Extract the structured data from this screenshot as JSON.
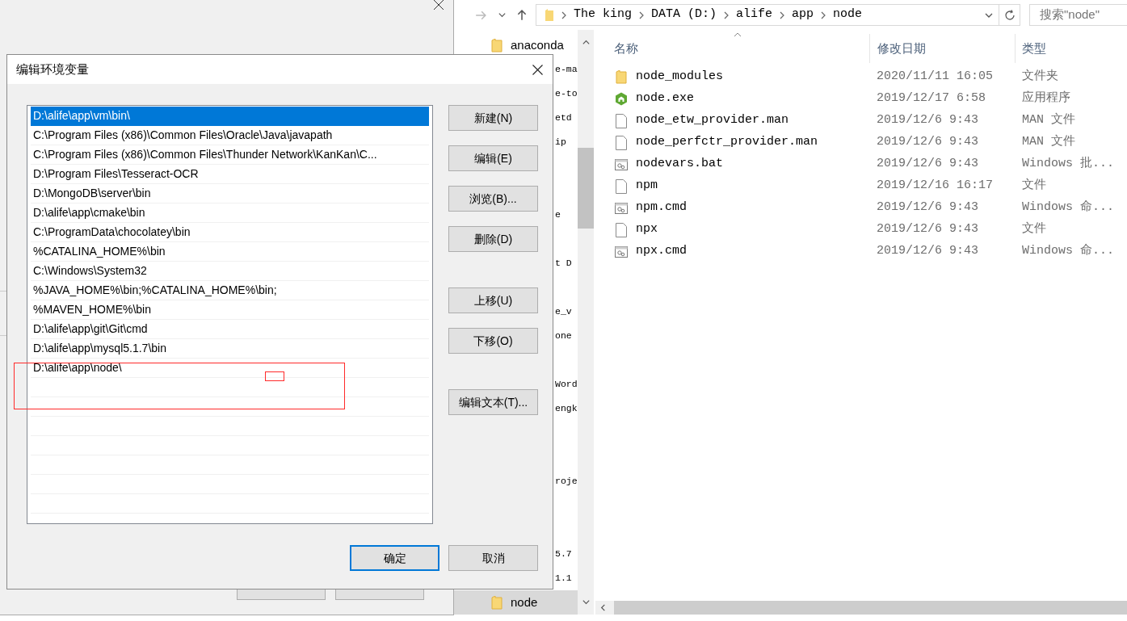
{
  "background_dialog": {
    "buttons": [
      {
        "default": false
      },
      {
        "default": false
      }
    ]
  },
  "explorer": {
    "address": {
      "crumbs": [
        "The king",
        "DATA (D:)",
        "alife",
        "app",
        "node"
      ]
    },
    "search": {
      "placeholder": "搜索\"node\""
    },
    "nav_items": [
      {
        "kind": "folder",
        "label": "anaconda",
        "selected": false
      },
      {
        "kind": "cut",
        "label": "e-ma"
      },
      {
        "kind": "cut",
        "label": "e-to"
      },
      {
        "kind": "cut",
        "label": "etd"
      },
      {
        "kind": "cut",
        "label": "ip"
      },
      {
        "kind": "hidden"
      },
      {
        "kind": "hidden"
      },
      {
        "kind": "cut",
        "label": "e"
      },
      {
        "kind": "hidden"
      },
      {
        "kind": "cut",
        "label": "t D"
      },
      {
        "kind": "hidden"
      },
      {
        "kind": "cut",
        "label": "e_v"
      },
      {
        "kind": "cut",
        "label": "one"
      },
      {
        "kind": "hidden"
      },
      {
        "kind": "cut",
        "label": "Word"
      },
      {
        "kind": "cut",
        "label": "engk"
      },
      {
        "kind": "hidden"
      },
      {
        "kind": "hidden"
      },
      {
        "kind": "cut",
        "label": "roje"
      },
      {
        "kind": "hidden"
      },
      {
        "kind": "hidden"
      },
      {
        "kind": "cut",
        "label": "5.7"
      },
      {
        "kind": "cut",
        "label": "1.1"
      },
      {
        "kind": "folder",
        "label": "node",
        "selected": true
      }
    ],
    "columns": [
      "名称",
      "修改日期",
      "类型"
    ],
    "files": [
      {
        "kind": "folder",
        "name": "node_modules",
        "modified": "2020/11/11 16:05",
        "type": "文件夹"
      },
      {
        "kind": "exe",
        "name": "node.exe",
        "modified": "2019/12/17 6:58",
        "type": "应用程序"
      },
      {
        "kind": "file",
        "name": "node_etw_provider.man",
        "modified": "2019/12/6 9:43",
        "type": "MAN 文件"
      },
      {
        "kind": "file",
        "name": "node_perfctr_provider.man",
        "modified": "2019/12/6 9:43",
        "type": "MAN 文件"
      },
      {
        "kind": "script",
        "name": "nodevars.bat",
        "modified": "2019/12/6 9:43",
        "type": "Windows 批..."
      },
      {
        "kind": "file",
        "name": "npm",
        "modified": "2019/12/16 16:17",
        "type": "文件"
      },
      {
        "kind": "script",
        "name": "npm.cmd",
        "modified": "2019/12/6 9:43",
        "type": "Windows 命..."
      },
      {
        "kind": "file",
        "name": "npx",
        "modified": "2019/12/6 9:43",
        "type": "文件"
      },
      {
        "kind": "script",
        "name": "npx.cmd",
        "modified": "2019/12/6 9:43",
        "type": "Windows 命..."
      }
    ]
  },
  "dialog": {
    "title": "编辑环境变量",
    "paths": [
      {
        "text": "D:\\alife\\app\\vm\\bin\\",
        "selected": true
      },
      {
        "text": "C:\\Program Files (x86)\\Common Files\\Oracle\\Java\\javapath",
        "selected": false
      },
      {
        "text": "C:\\Program Files (x86)\\Common Files\\Thunder Network\\KanKan\\C...",
        "selected": false
      },
      {
        "text": "D:\\Program Files\\Tesseract-OCR",
        "selected": false
      },
      {
        "text": "D:\\MongoDB\\server\\bin",
        "selected": false
      },
      {
        "text": "D:\\alife\\app\\cmake\\bin",
        "selected": false
      },
      {
        "text": "C:\\ProgramData\\chocolatey\\bin",
        "selected": false
      },
      {
        "text": "%CATALINA_HOME%\\bin",
        "selected": false
      },
      {
        "text": "C:\\Windows\\System32",
        "selected": false
      },
      {
        "text": "%JAVA_HOME%\\bin;%CATALINA_HOME%\\bin;",
        "selected": false
      },
      {
        "text": "%MAVEN_HOME%\\bin",
        "selected": false
      },
      {
        "text": "D:\\alife\\app\\git\\Git\\cmd",
        "selected": false
      },
      {
        "text": "D:\\alife\\app\\mysql5.1.7\\bin",
        "selected": false
      },
      {
        "text": "D:\\alife\\app\\node\\",
        "selected": false
      }
    ],
    "button_groups": [
      [
        "新建(N)",
        "编辑(E)",
        "浏览(B)...",
        "删除(D)"
      ],
      [
        "上移(U)",
        "下移(O)"
      ],
      [
        "编辑文本(T)..."
      ]
    ],
    "footer_buttons": [
      {
        "label": "确定",
        "default": true
      },
      {
        "label": "取消",
        "default": false
      }
    ]
  }
}
